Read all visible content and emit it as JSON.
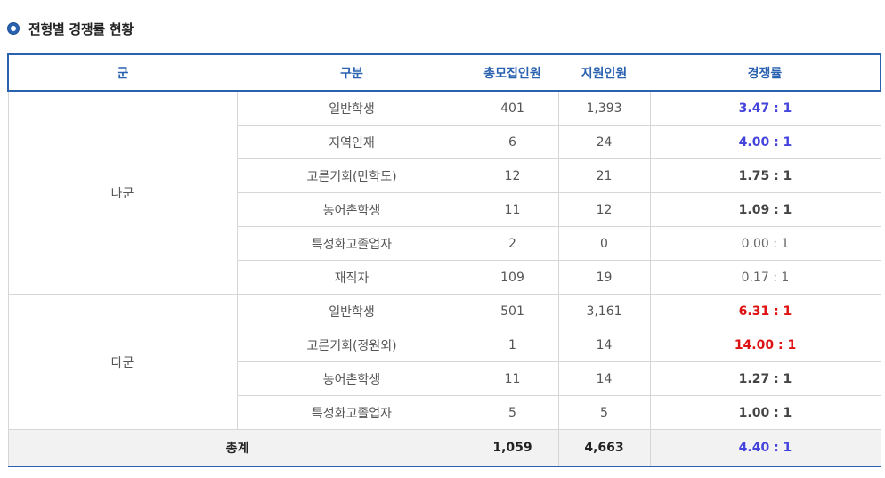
{
  "section": {
    "title": "전형별 경쟁률 현황"
  },
  "table": {
    "headers": {
      "group": "군",
      "category": "구분",
      "quota": "총모집인원",
      "applicants": "지원인원",
      "ratio": "경쟁률"
    },
    "groups": [
      {
        "name": "나군",
        "rows": [
          {
            "category": "일반학생",
            "quota": "401",
            "applicants": "1,393",
            "ratio": "3.47 : 1",
            "ratio_style": "blue"
          },
          {
            "category": "지역인재",
            "quota": "6",
            "applicants": "24",
            "ratio": "4.00 : 1",
            "ratio_style": "blue"
          },
          {
            "category": "고른기회(만학도)",
            "quota": "12",
            "applicants": "21",
            "ratio": "1.75 : 1",
            "ratio_style": "dark"
          },
          {
            "category": "농어촌학생",
            "quota": "11",
            "applicants": "12",
            "ratio": "1.09 : 1",
            "ratio_style": "dark"
          },
          {
            "category": "특성화고졸업자",
            "quota": "2",
            "applicants": "0",
            "ratio": "0.00 : 1",
            "ratio_style": "normal"
          },
          {
            "category": "재직자",
            "quota": "109",
            "applicants": "19",
            "ratio": "0.17 : 1",
            "ratio_style": "normal"
          }
        ]
      },
      {
        "name": "다군",
        "rows": [
          {
            "category": "일반학생",
            "quota": "501",
            "applicants": "3,161",
            "ratio": "6.31 : 1",
            "ratio_style": "red"
          },
          {
            "category": "고른기회(정원외)",
            "quota": "1",
            "applicants": "14",
            "ratio": "14.00 : 1",
            "ratio_style": "red"
          },
          {
            "category": "농어촌학생",
            "quota": "11",
            "applicants": "14",
            "ratio": "1.27 : 1",
            "ratio_style": "dark"
          },
          {
            "category": "특성화고졸업자",
            "quota": "5",
            "applicants": "5",
            "ratio": "1.00 : 1",
            "ratio_style": "dark"
          }
        ]
      }
    ],
    "total": {
      "label": "총계",
      "quota": "1,059",
      "applicants": "4,663",
      "ratio": "4.40 : 1"
    }
  },
  "colors": {
    "accent": "#2a62b0",
    "ratio_blue": "#4444dd",
    "ratio_red": "#dd1111"
  }
}
